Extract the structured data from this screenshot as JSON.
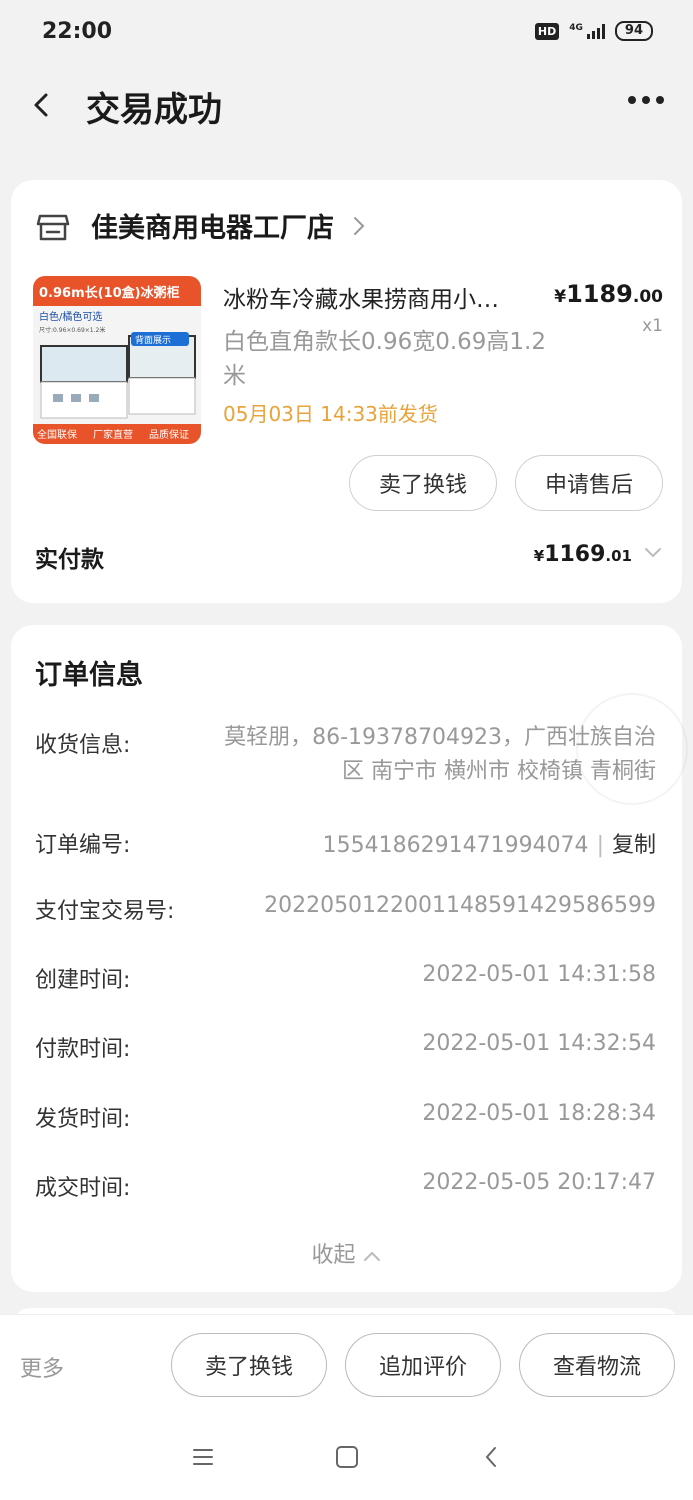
{
  "status_bar": {
    "time": "22:00",
    "hd": "HD",
    "network": "4G",
    "battery": "94"
  },
  "header": {
    "title": "交易成功"
  },
  "store": {
    "name": "佳美商用电器工厂店",
    "product": {
      "thumb_headline": "0.96m长(10盒)冰粥柜",
      "thumb_color_note": "白色/橘色可选",
      "thumb_size_note": "尺寸:0.96×0.69×1.2米",
      "thumb_back_label": "背面展示",
      "thumb_footer": [
        "全国联保",
        "厂家直营",
        "品质保证"
      ],
      "title": "冰粉车冷藏水果捞商用小…",
      "spec": "白色直角款长0.96宽0.69高1.2米",
      "ship_deadline": "05月03日 14:33前发货",
      "price_currency": "¥",
      "price_int": "1189",
      "price_dec": ".00",
      "quantity": "x1"
    },
    "actions": {
      "resell": "卖了换钱",
      "after_sale": "申请售后"
    },
    "paid": {
      "label": "实付款",
      "currency": "¥",
      "amount_int": "1169",
      "amount_dec": ".01"
    }
  },
  "order": {
    "title": "订单信息",
    "receiver_label": "收货信息:",
    "receiver_value": "莫轻朋，86-19378704923，广西壮族自治区 南宁市 横州市 校椅镇 青桐街",
    "order_no_label": "订单编号:",
    "order_no_value": "1554186291471994074",
    "copy_label": "复制",
    "alipay_label": "支付宝交易号:",
    "alipay_value": "2022050122001148591429586599",
    "created_label": "创建时间:",
    "created_value": "2022-05-01 14:31:58",
    "paid_label": "付款时间:",
    "paid_value": "2022-05-01 14:32:54",
    "shipped_label": "发货时间:",
    "shipped_value": "2022-05-01 18:28:34",
    "completed_label": "成交时间:",
    "completed_value": "2022-05-05 20:17:47",
    "collapse_label": "收起"
  },
  "bottom_bar": {
    "more": "更多",
    "resell": "卖了换钱",
    "add_review": "追加评价",
    "logistics": "查看物流"
  },
  "colors": {
    "ship_deadline": "#e8a33a",
    "background": "#f2f2f2"
  }
}
